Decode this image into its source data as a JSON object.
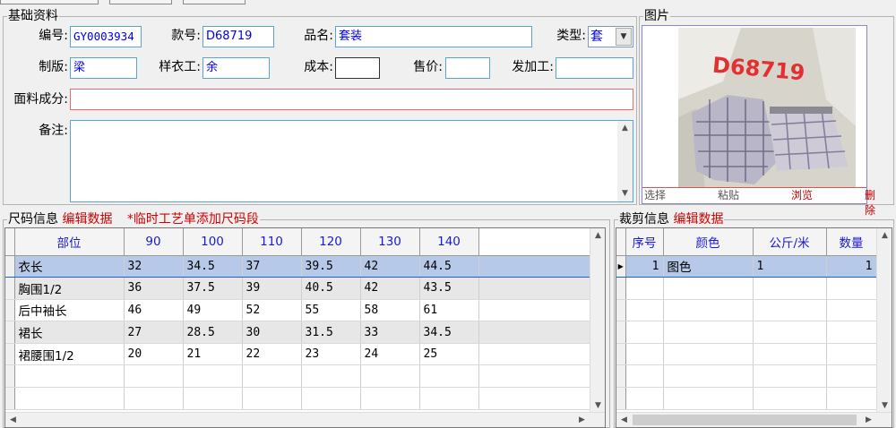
{
  "basic": {
    "legend": "基础资料",
    "code_label": "编号:",
    "code_value": "GY0003934",
    "style_no_label": "款号:",
    "style_no_value": "D68719",
    "name_label": "品名:",
    "name_value": "套装",
    "type_label": "类型:",
    "type_value": "套",
    "pattern_label": "制版:",
    "pattern_value": "梁",
    "sample_label": "样衣工:",
    "sample_value": "余",
    "cost_label": "成本:",
    "cost_value": "",
    "price_label": "售价:",
    "price_value": "",
    "processor_label": "发加工:",
    "processor_value": "",
    "fabric_label": "面料成分:",
    "fabric_value": "",
    "remark_label": "备注:",
    "remark_value": ""
  },
  "image_panel": {
    "legend": "图片",
    "watermark": "D68719",
    "actions": [
      "选择",
      "粘贴",
      "浏览",
      "删除"
    ]
  },
  "size_info": {
    "legend": "尺码信息",
    "edit_link": "编辑数据",
    "temp_link": "*临时工艺单添加尺码段",
    "columns": [
      "部位",
      "90",
      "100",
      "110",
      "120",
      "130",
      "140"
    ],
    "rows": [
      [
        "衣长",
        "32",
        "34.5",
        "37",
        "39.5",
        "42",
        "44.5"
      ],
      [
        "胸围1/2",
        "36",
        "37.5",
        "39",
        "40.5",
        "42",
        "43.5"
      ],
      [
        "后中袖长",
        "46",
        "49",
        "52",
        "55",
        "58",
        "61"
      ],
      [
        "裙长",
        "27",
        "28.5",
        "30",
        "31.5",
        "33",
        "34.5"
      ],
      [
        "裙腰围1/2",
        "20",
        "21",
        "22",
        "23",
        "24",
        "25"
      ]
    ]
  },
  "cut_info": {
    "legend": "裁剪信息",
    "edit_link": "编辑数据",
    "columns": [
      "序号",
      "颜色",
      "公斤/米",
      "数量"
    ],
    "rows": [
      [
        "1",
        "图色",
        "1",
        "1"
      ]
    ]
  },
  "colors": {
    "label_red": "#d00000",
    "value_blue": "#0000e0",
    "selection": "#b6c9e8"
  },
  "icons": [
    "scroll-up-icon",
    "scroll-down-icon",
    "scroll-left-icon",
    "scroll-right-icon",
    "dropdown-arrow-icon",
    "row-pointer-icon"
  ]
}
